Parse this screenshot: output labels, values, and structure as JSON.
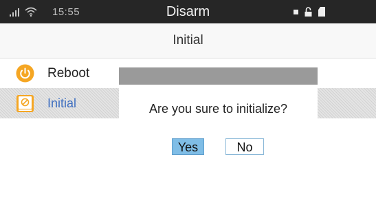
{
  "status_bar": {
    "time": "15:55",
    "title": "Disarm",
    "icons": [
      "signal-icon",
      "wifi-icon",
      "dot-icon",
      "lock-icon",
      "sd-card-icon"
    ]
  },
  "header": {
    "title": "Initial"
  },
  "menu": {
    "items": [
      {
        "label": "Reboot",
        "icon": "power-icon",
        "selected": false
      },
      {
        "label": "Initial",
        "icon": "initialize-icon",
        "selected": true
      }
    ]
  },
  "dialog": {
    "message": "Are you sure to initialize?",
    "yes_label": "Yes",
    "no_label": "No"
  },
  "colors": {
    "status_bar_bg": "#262626",
    "icon_orange": "#f5a623",
    "selected_text": "#3f6fc0",
    "dialog_bar": "#9a9a9a",
    "yes_button": "#7fbde6"
  }
}
